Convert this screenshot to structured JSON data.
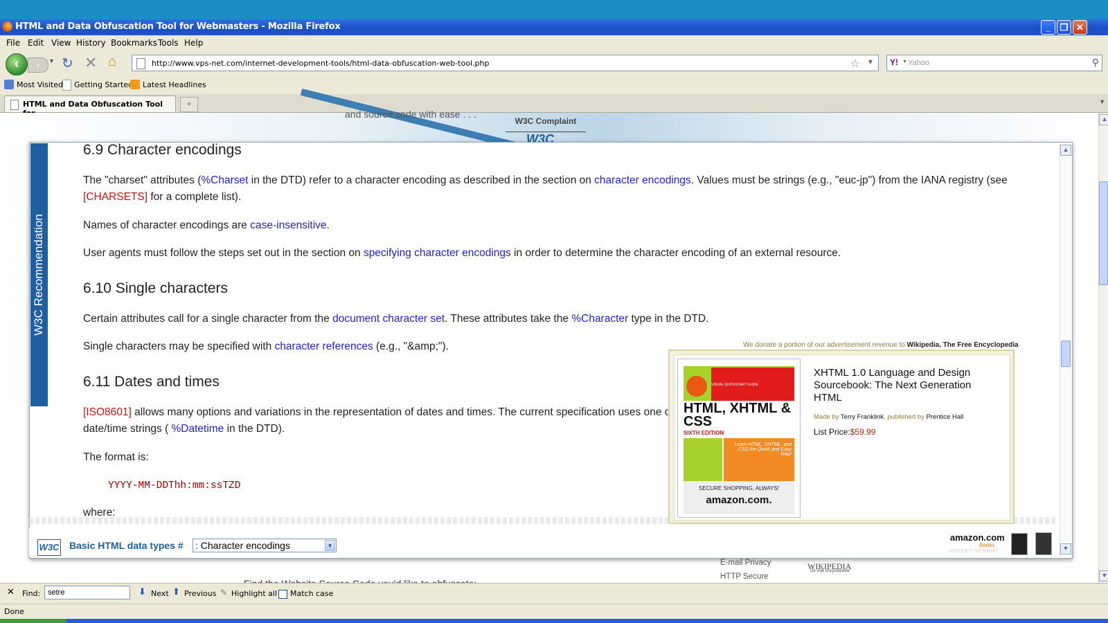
{
  "window": {
    "title": "HTML and Data Obfuscation Tool for Webmasters - Mozilla Firefox",
    "minimize": "_",
    "restore": "❐",
    "close": "✕"
  },
  "menu": [
    "File",
    "Edit",
    "View",
    "History",
    "Bookmarks",
    "Tools",
    "Help"
  ],
  "nav": {
    "url": "http://www.vps-net.com/internet-development-tools/html-data-obfuscation-web-tool.php",
    "search_placeholder": "Yahoo"
  },
  "bookmarks": [
    "Most Visited",
    "Getting Started",
    "Latest Headlines"
  ],
  "tab": {
    "label": "HTML and Data Obfuscation Tool for ...",
    "new_tab": "+"
  },
  "page_header": {
    "w3c_complaint": "W3C Complaint",
    "partial_text": "and source code with ease . . .",
    "partial_logo": "W3C"
  },
  "popup": {
    "sidebar_title": "W3C Recommendation",
    "section_69": {
      "heading": "6.9 Character encodings",
      "p1_a": "The \"charset\" attributes (",
      "p1_link1": "%Charset",
      "p1_b": " in the DTD) refer to a character encoding as described in the section on ",
      "p1_link2": "character encodings",
      "p1_c": ". Values must be strings (e.g., \"euc-jp\") from the IANA registry (see",
      "p1_link3": "[CHARSETS]",
      "p1_d": " for a complete list).",
      "p2_a": "Names of character encodings are ",
      "p2_link": "case-insensitive",
      "p2_b": ".",
      "p3_a": "User agents must follow the steps set out in the section on ",
      "p3_link": "specifying character encodings",
      "p3_b": " in order to determine the character encoding of an external resource."
    },
    "section_610": {
      "heading": "6.10 Single characters",
      "p1_a": "Certain attributes call for a single character from the ",
      "p1_link1": "document character set",
      "p1_b": ". These attributes take the ",
      "p1_link2": "%Character",
      "p1_c": " type in the DTD.",
      "p2_a": "Single characters may be specified with ",
      "p2_link": "character references",
      "p2_b": " (e.g., \"&amp;\")."
    },
    "section_611": {
      "heading": "6.11 Dates and times",
      "p1_link1": "[ISO8601]",
      "p1_a": " allows many options and variations in the representation of dates and times. The current specification uses one o",
      "p1_b": "date/time strings ( ",
      "p1_link2": "%Datetime",
      "p1_c": " in the DTD).",
      "p2": "The format is:",
      "code": "YYYY-MM-DDThh:mm:ssTZD",
      "p3": "where:"
    },
    "bottom": {
      "w3c_logo": "W3C",
      "label": "Basic HTML data types #",
      "select_value": ": Character encodings"
    }
  },
  "ad": {
    "donate_prefix": "We donate a portion of our advertisement revenue to ",
    "donate_target": "Wikipedia, The Free Encyclopedia",
    "book_series": "VISUAL QUICKSTART GUIDE",
    "book_cover_title": "HTML, XHTML & CSS",
    "book_edition": "SIXTH EDITION",
    "book_tagline": "Learn HTML, XHTML, and CSS the Quick and Easy Way!",
    "book_shopping": "SECURE SHOPPING, ALWAYS!",
    "book_store": "amazon.com.",
    "title": "XHTML 1.0 Language and Design Sourcebook: The Next Generation HTML",
    "made_by_label": "Made by ",
    "author": "Terry Franklink",
    "published_label": ", published by ",
    "publisher": "Prentice Hall",
    "list_price_label": "List Price:",
    "list_price": "$59.99",
    "amazon_books": "amazon.com",
    "amazon_sub": "Books",
    "amazon_ad": "ADVERTISEMENT"
  },
  "below_page": {
    "email_privacy": "E-mail Privacy",
    "http_secure": "HTTP Secure",
    "wikipedia": "WIKIPEDIA",
    "wikipedia_sub": "De vrije encyclopedie",
    "find_heading": "Find the Website Source Code you'd like to obfuscate:"
  },
  "findbar": {
    "close": "✕",
    "label": "Find:",
    "value": "setre",
    "next": "Next",
    "previous": "Previous",
    "highlight": "Highlight all",
    "match_case": "Match case"
  },
  "status": "Done"
}
